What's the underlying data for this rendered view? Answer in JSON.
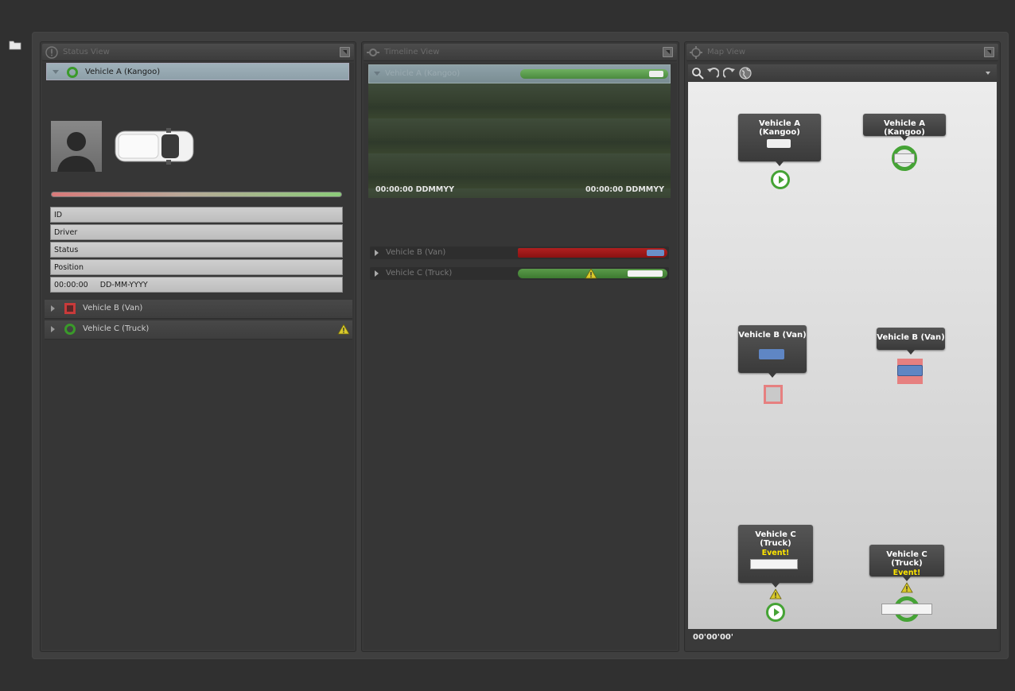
{
  "colors": {
    "ok": "#45a335",
    "alert": "#c83a3a",
    "warning": "#d8c92a",
    "event_text": "#ffe600"
  },
  "status_view": {
    "title": "Status View",
    "vehicles": [
      {
        "label": "Vehicle A (Kangoo)",
        "status": "ok",
        "expanded": true
      },
      {
        "label": "Vehicle B (Van)",
        "status": "alert",
        "expanded": false
      },
      {
        "label": "Vehicle C (Truck)",
        "status": "ok",
        "expanded": false,
        "warning": true
      }
    ],
    "fields": [
      "ID",
      "Driver",
      "Status",
      "Position",
      "00:00:00     DD-MM-YYYY"
    ]
  },
  "timeline_view": {
    "title": "Timeline View",
    "rows": [
      {
        "label": "Vehicle A (Kangoo)",
        "status": "ok"
      },
      {
        "label": "Vehicle B (Van)",
        "status": "alert"
      },
      {
        "label": "Vehicle C (Truck)",
        "status": "ok",
        "warning": true
      }
    ],
    "start_time": "00:00:00 DDMMYY",
    "end_time": "00:00:00 DDMMYY"
  },
  "map_view": {
    "title": "Map View",
    "toolbar_icons": [
      "search-icon",
      "undo-icon",
      "redo-icon",
      "globe-icon"
    ],
    "callouts": {
      "a_left": "Vehicle A (Kangoo)",
      "a_right": "Vehicle A (Kangoo)",
      "b_left": "Vehicle B (Van)",
      "b_right": "Vehicle B (Van)",
      "c_left": "Vehicle C (Truck)",
      "c_right": "Vehicle C (Truck)",
      "event": "Event!"
    },
    "footer_time": "00'00'00'"
  }
}
